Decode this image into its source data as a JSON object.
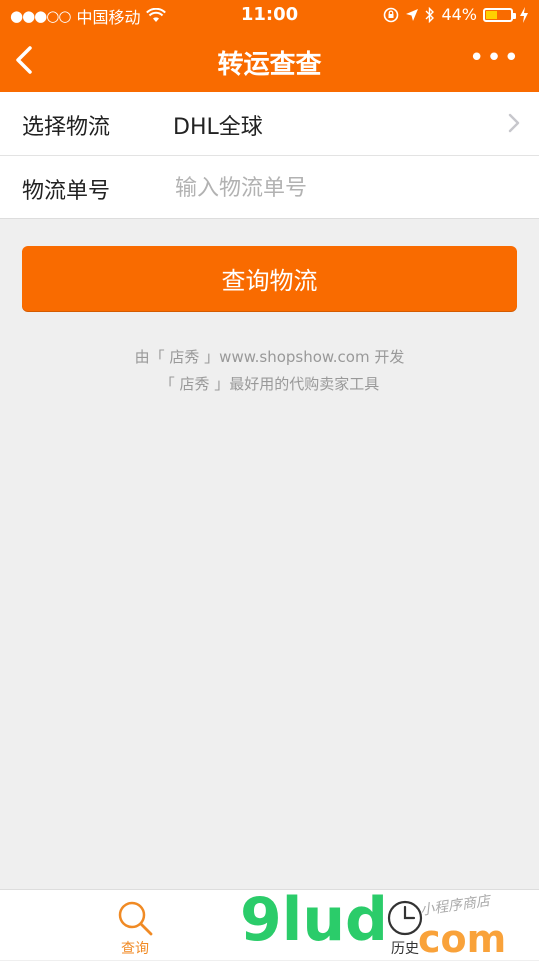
{
  "status": {
    "signal": "●●●○○",
    "carrier": "中国移动",
    "time": "11:00",
    "battery_text": "44%",
    "battery_level": 0.44
  },
  "nav": {
    "title": "转运查查",
    "back_icon": "chevron-left-icon",
    "more_icon": "more-dots-icon",
    "more_glyph": "•••"
  },
  "form": {
    "rows": [
      {
        "label": "选择物流",
        "value": "DHL全球"
      },
      {
        "label": "物流单号",
        "value": "",
        "placeholder": "输入物流单号"
      }
    ]
  },
  "button": {
    "label": "查询物流"
  },
  "footer": {
    "line1": "由「 店秀 」www.shopshow.com 开发",
    "line2": "「 店秀 」最好用的代购卖家工具"
  },
  "tabs": [
    {
      "label": "查询",
      "icon": "search-icon",
      "active": true
    },
    {
      "label": "历史",
      "icon": "clock-icon",
      "active": false
    }
  ],
  "watermark": {
    "brand": "9lud",
    "suffix": "com",
    "small": "小程序商店"
  },
  "colors": {
    "accent": "#f96b00",
    "tab_active": "#f08a24"
  }
}
